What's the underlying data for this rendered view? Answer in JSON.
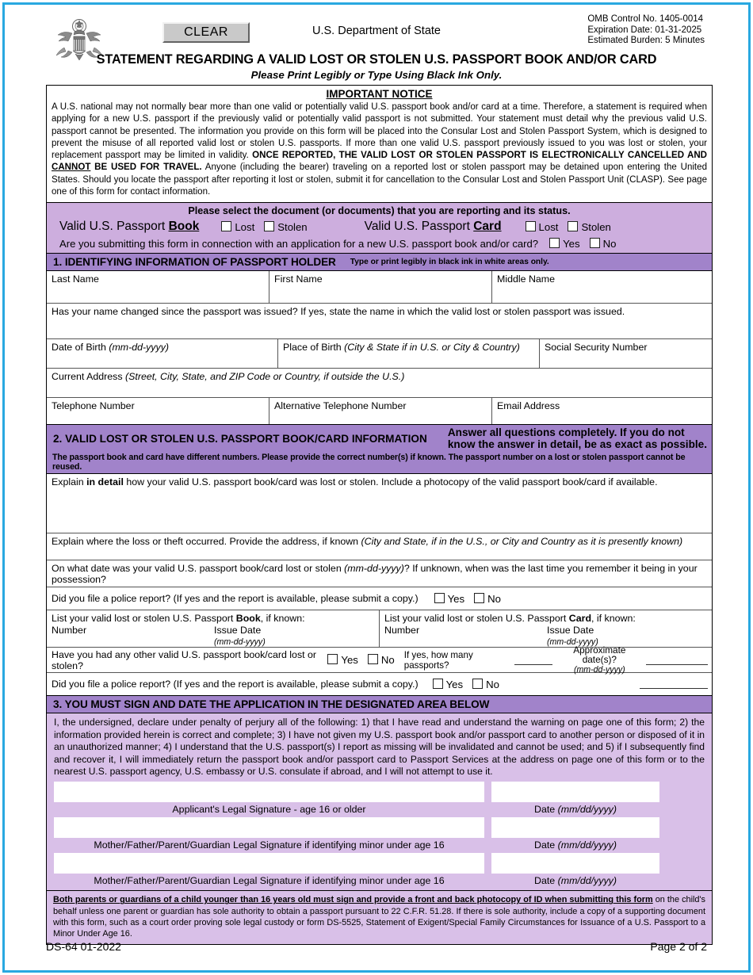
{
  "header": {
    "clear_button": "CLEAR",
    "department": "U.S. Department of State",
    "omb_control": "OMB Control No. 1405-0014",
    "omb_expiration": "Expiration Date: 01-31-2025",
    "omb_burden": "Estimated Burden: 5 Minutes",
    "title": "STATEMENT REGARDING A VALID LOST OR STOLEN U.S. PASSPORT BOOK AND/OR CARD",
    "subtitle": "Please Print Legibly or Type Using Black Ink Only.",
    "seal_alt": "great-seal-of-the-united-states"
  },
  "notice": {
    "heading": "IMPORTANT NOTICE",
    "p1": "A U.S. national may not normally bear more than one valid or potentially valid U.S. passport book and/or card at a time. Therefore, a statement is required when applying for a new U.S. passport if the previously valid or potentially valid passport is not submitted. Your statement must detail why the previous valid U.S. passport cannot be presented. The information you provide on this form will be placed into the Consular Lost and Stolen Passport System, which is designed to prevent the misuse of all reported valid lost or stolen U.S. passports. If more than one valid U.S. passport previously issued to you was lost or stolen, your replacement passport may be limited in validity. ",
    "bold1": "ONCE REPORTED, THE VALID LOST OR STOLEN PASSPORT IS ELECTRONICALLY CANCELLED AND ",
    "bold1_underline": "CANNOT",
    "bold1b": " BE USED FOR TRAVEL.",
    "p2": " Anyone (including the bearer) traveling on a reported lost or stolen passport may be detained upon entering the United States. Should you locate the passport after reporting it lost or stolen, submit it for cancellation to the Consular Lost and Stolen Passport Unit (CLASP). See page one of this form for contact information."
  },
  "select": {
    "title": "Please select the document (or documents) that you are reporting and its status.",
    "book_label_pre": "Valid U.S. Passport ",
    "book_label_bold": "Book",
    "card_label_pre": "Valid U.S. Passport ",
    "card_label_bold": "Card",
    "lost": "Lost",
    "stolen": "Stolen",
    "question": "Are you submitting this form in connection with an application for a new U.S. passport book and/or card?",
    "yes": "Yes",
    "no": "No"
  },
  "section1": {
    "heading": "1.  IDENTIFYING INFORMATION OF PASSPORT HOLDER",
    "note": "Type or print legibly in black ink in white areas only.",
    "last_name": "Last Name",
    "first_name": "First Name",
    "middle_name": "Middle Name",
    "name_changed": "Has your name changed since the passport was issued? If yes, state the name in which the valid lost or stolen passport was issued.",
    "dob_label": "Date of Birth ",
    "dob_format": "(mm-dd-yyyy)",
    "pob_label": "Place of Birth ",
    "pob_format": "(City & State if in U.S. or City & Country)",
    "ssn": "Social Security Number",
    "address_label": "Current Address ",
    "address_format": "(Street, City, State, and ZIP Code or Country, if outside the U.S.)",
    "telephone": "Telephone Number",
    "alt_telephone": "Alternative Telephone Number",
    "email": "Email Address"
  },
  "section2": {
    "heading": "2. VALID LOST OR STOLEN U.S. PASSPORT BOOK/CARD INFORMATION",
    "note_line1": "Answer all questions completely. If you do not",
    "note_line2": "know the answer in detail, be as exact as possible.",
    "subnote": "The passport book and card have different numbers. Please provide the correct number(s) if known. The passport number on a lost or stolen passport cannot be reused.",
    "explain_pre": "Explain ",
    "explain_bold": "in detail",
    "explain_post": " how your valid U.S. passport book/card was lost or stolen. Include a photocopy of the valid passport book/card if available.",
    "where_label": "Explain where the loss or theft occurred. Provide the address, if known ",
    "where_italic": "(City and State, if in the U.S., or City and Country as it is presently known)",
    "date_lost_pre": "On what date was your valid U.S. passport book/card lost or stolen ",
    "date_lost_italic": "(mm-dd-yyyy)",
    "date_lost_post": "? If unknown, when was the last time you remember it being in your possession?",
    "police_report": "Did you file a police report? (If yes and the report is available, please submit a copy.)",
    "yes": "Yes",
    "no": "No",
    "book_list_pre": "List your valid lost or stolen U.S. Passport ",
    "book_list_bold": "Book",
    "book_list_post": ", if known:",
    "card_list_pre": "List your valid lost or stolen U.S. Passport ",
    "card_list_bold": "Card",
    "card_list_post": ", if known:",
    "number": "Number",
    "issue_date": "Issue Date",
    "issue_date_format": "(mm-dd-yyyy)",
    "other_lost": "Have you had any other valid U.S. passport book/card lost or stolen?",
    "how_many": "If yes, how many passports?",
    "approx_dates": "Approximate date(s)?",
    "approx_format": "(mm-dd-yyyy)",
    "police_report2": "Did you file a police report? (If yes and the report is available, please submit a copy.)"
  },
  "section3": {
    "heading": "3. YOU MUST SIGN AND DATE THE APPLICATION IN THE DESIGNATED AREA BELOW",
    "declaration": "I, the undersigned, declare under penalty of perjury all of the following: 1) that I have read and understand the warning on page one of this form; 2) the information provided herein is correct and complete; 3) I have not given my U.S. passport book and/or passport card to another person or disposed of it in an unauthorized manner; 4) I understand that the U.S. passport(s) I report as missing will be invalidated and cannot be used; and 5) if I subsequently find and recover it, I will immediately return the passport book and/or passport card to Passport Services at the address on page one of this form or to the nearest U.S. passport agency, U.S. embassy or U.S. consulate if abroad, and I will not attempt to use it.",
    "signatures": [
      {
        "caption": "Applicant's Legal Signature - age 16 or older",
        "date_label": "Date ",
        "date_format": "(mm/dd/yyyy)"
      },
      {
        "caption": "Mother/Father/Parent/Guardian Legal Signature if identifying minor under age 16",
        "date_label": "Date ",
        "date_format": "(mm/dd/yyyy)"
      },
      {
        "caption": "Mother/Father/Parent/Guardian Legal Signature if identifying minor under age 16",
        "date_label": "Date ",
        "date_format": "(mm/dd/yyyy)"
      }
    ],
    "parents_bold": "Both parents or guardians of a child younger than 16 years old must sign and provide a front and back photocopy of ID when submitting this form",
    "parents_rest": " on the child's behalf unless one parent or guardian has sole authority to obtain a passport pursuant to 22 C.F.R. 51.28. If there is sole authority, include a copy of a supporting document with this form, such as a court order proving sole legal custody or form DS-5525, Statement of Exigent/Special Family Circumstances for Issuance of a U.S. Passport to a Minor Under Age 16."
  },
  "footer": {
    "form_id": "DS-64 01-2022",
    "page": "Page 2 of 2"
  },
  "colors": {
    "frame_blue": "#29a8e0",
    "header_purple": "#a183ca",
    "panel_purple": "#cdaede",
    "panel_purple_light": "#d9c0e8"
  }
}
